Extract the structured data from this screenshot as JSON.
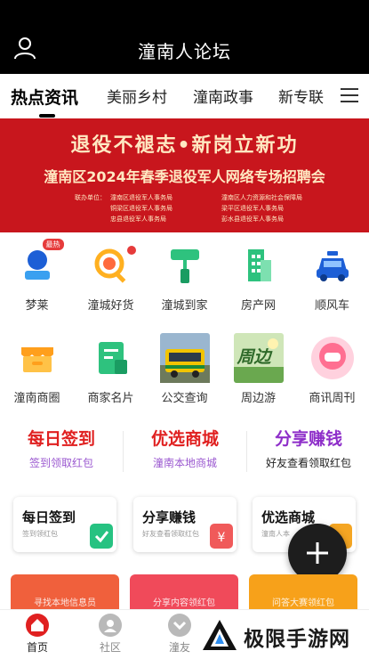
{
  "header": {
    "title": "潼南人论坛"
  },
  "tabs": [
    {
      "label": "热点资讯"
    },
    {
      "label": "美丽乡村"
    },
    {
      "label": "潼南政事"
    },
    {
      "label": "新专联"
    }
  ],
  "banner": {
    "headline": "退役不褪志•新岗立新功",
    "subheadline": "潼南区2024年春季退役军人网络专场招聘会",
    "organizers": [
      [
        "联办单位：",
        "潼南区退役军人事务局",
        "潼南区人力资源和社会保障局"
      ],
      [
        "",
        "铜梁区退役军人事务局",
        "梁平区退役军人事务局"
      ],
      [
        "",
        "忠县退役军人事务局",
        "彭水县退役军人事务局"
      ]
    ]
  },
  "grid": [
    {
      "label": "梦莱",
      "icon": "person-stamp-icon",
      "badge": "最热"
    },
    {
      "label": "潼城好货",
      "icon": "magnifier-coin-icon",
      "dot": true
    },
    {
      "label": "潼城到家",
      "icon": "paint-roller-icon"
    },
    {
      "label": "房产网",
      "icon": "building-icon"
    },
    {
      "label": "顺风车",
      "icon": "car-icon"
    },
    {
      "label": "潼南商圈",
      "icon": "shop-icon"
    },
    {
      "label": "商家名片",
      "icon": "business-card-icon"
    },
    {
      "label": "公交查询",
      "icon": "bus-photo-icon"
    },
    {
      "label": "周边游",
      "icon": "travel-photo-icon",
      "photo_text": "周边"
    },
    {
      "label": "商讯周刊",
      "icon": "bubble-icon"
    }
  ],
  "promo": [
    {
      "title": "每日签到",
      "subtitle": "签到领取红包",
      "title_color": "#e02020",
      "subtitle_color": "#9b59d0"
    },
    {
      "title": "优选商城",
      "subtitle": "潼南本地商城",
      "title_color": "#e02020",
      "subtitle_color": "#9b59d0"
    },
    {
      "title": "分享赚钱",
      "subtitle": "好友查看领取红包",
      "title_color": "#8e2ec9",
      "subtitle_color": "#222222"
    }
  ],
  "cards": [
    {
      "title": "每日签到",
      "subtitle": "签到领红包",
      "icon": "check-bag-icon",
      "icon_color": "#26c281"
    },
    {
      "title": "分享赚钱",
      "subtitle": "好友查看领取红包",
      "icon": "yen-bag-icon",
      "icon_color": "#f05a5a"
    },
    {
      "title": "优选商城",
      "subtitle": "潼南人本",
      "icon": "cart-icon",
      "icon_color": "#f5a623"
    }
  ],
  "strip": [
    {
      "label": "寻找本地信息员",
      "color": "#f0603c"
    },
    {
      "label": "分享内容领红包",
      "color": "#f04a5a"
    },
    {
      "label": "问答大赛领红包",
      "color": "#f7a11a"
    }
  ],
  "bottom_nav": [
    {
      "label": "首页",
      "icon": "home-icon",
      "active": true
    },
    {
      "label": "社区",
      "icon": "community-icon"
    },
    {
      "label": "潼友",
      "icon": "friends-icon"
    }
  ],
  "watermark": {
    "text": "极限手游网",
    "icon": "logo-icon"
  },
  "colors": {
    "brand_red": "#c8161d",
    "active_text": "#e02020"
  }
}
